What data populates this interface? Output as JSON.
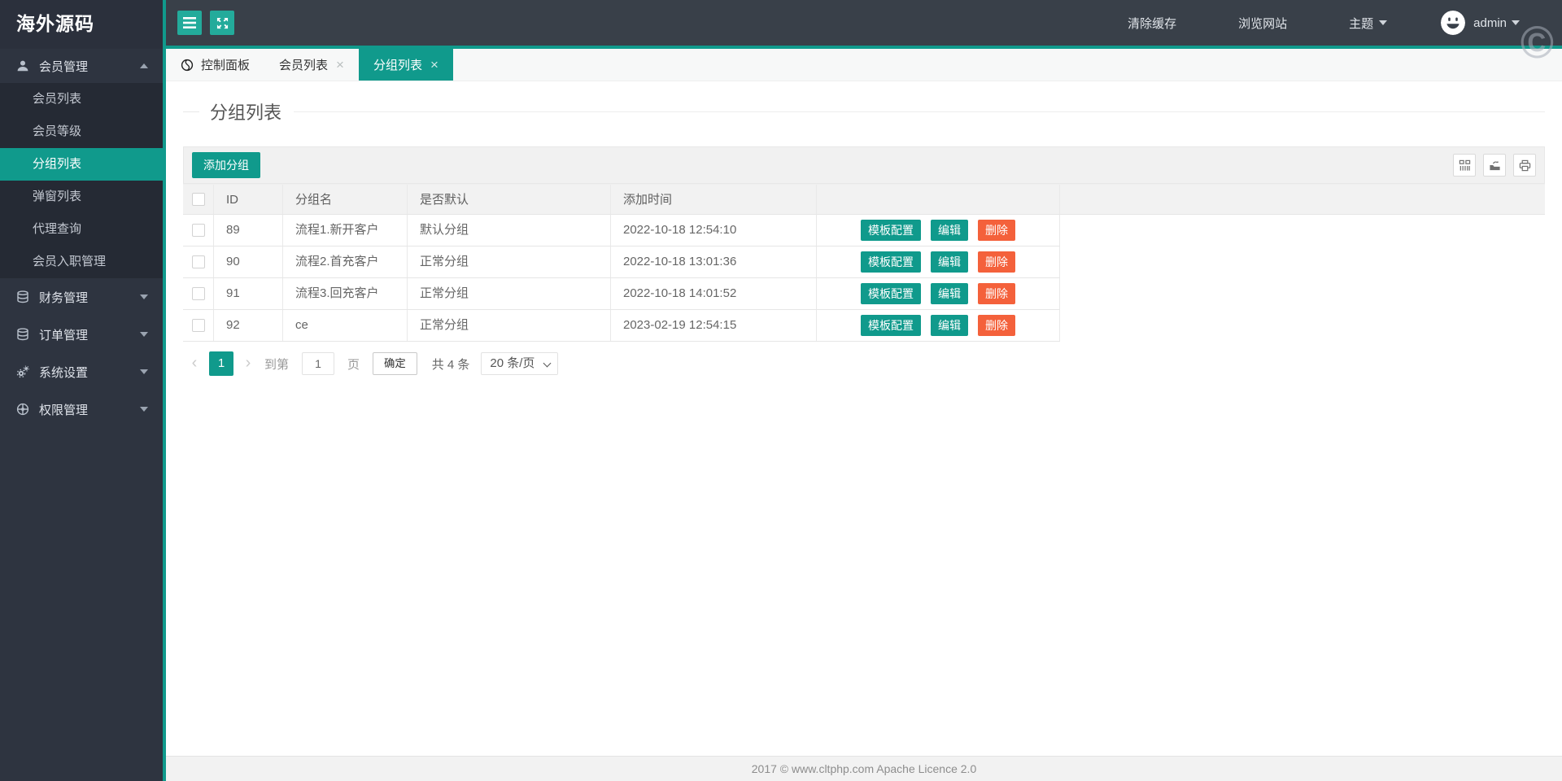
{
  "app": {
    "logo_text": "海外源码"
  },
  "topbar": {
    "links": [
      {
        "label": "清除缓存"
      },
      {
        "label": "浏览网站"
      }
    ],
    "theme_label": "主题",
    "username": "admin",
    "watermark": "©"
  },
  "sidebar": {
    "member_group": "会员管理",
    "member_children": [
      "会员列表",
      "会员等级",
      "分组列表",
      "弹窗列表",
      "代理查询",
      "会员入职管理"
    ],
    "active_child": "分组列表",
    "groups": [
      "财务管理",
      "订单管理",
      "系统设置",
      "权限管理"
    ]
  },
  "tabs": [
    "控制面板",
    "会员列表",
    "分组列表"
  ],
  "page": {
    "title": "分组列表"
  },
  "toolbar": {
    "add_label": "添加分组"
  },
  "table": {
    "headers": [
      "ID",
      "分组名",
      "是否默认",
      "添加时间"
    ],
    "rows": [
      {
        "id": "89",
        "name": "流程1.新开客户",
        "is_default": "默认分组",
        "added": "2022-10-18 12:54:10"
      },
      {
        "id": "90",
        "name": "流程2.首充客户",
        "is_default": "正常分组",
        "added": "2022-10-18 13:01:36"
      },
      {
        "id": "91",
        "name": "流程3.回充客户",
        "is_default": "正常分组",
        "added": "2022-10-18 14:01:52"
      },
      {
        "id": "92",
        "name": "ce",
        "is_default": "正常分组",
        "added": "2023-02-19 12:54:15"
      }
    ],
    "actions": [
      "模板配置",
      "编辑",
      "删除"
    ]
  },
  "pagination": {
    "current_page": "1",
    "goto_prefix": "到第",
    "page_input_value": "1",
    "goto_suffix": "页",
    "confirm_label": "确定",
    "total_label": "共 4 条",
    "page_size_label": "20 条/页"
  },
  "footer": {
    "text": "2017 ©  www.cltphp.com  Apache Licence 2.0"
  },
  "colors": {
    "accent": "#109a8c",
    "accent_light": "#23ab9b",
    "danger": "#f4613b",
    "topbar_bg": "#394049",
    "sidebar_bg": "#2e3440",
    "submenu_bg": "#252a34",
    "band_bg": "#f1f1f1"
  }
}
